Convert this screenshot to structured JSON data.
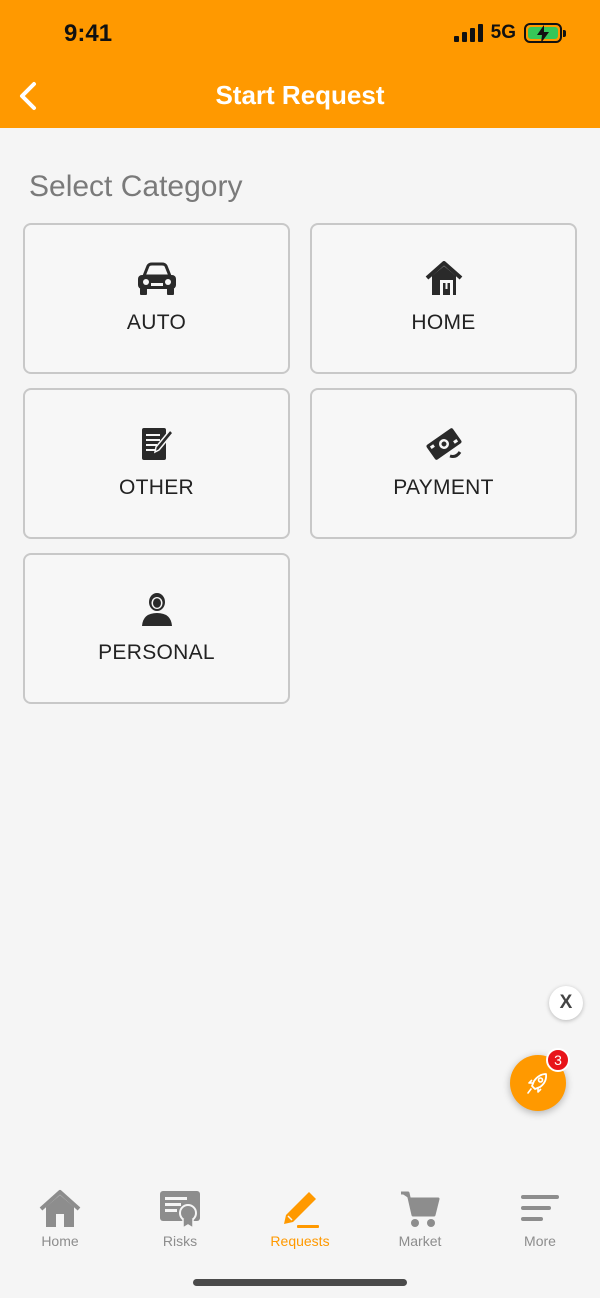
{
  "status_bar": {
    "time": "9:41",
    "network": "5G"
  },
  "header": {
    "title": "Start Request",
    "back_icon": "chevron-left-icon"
  },
  "section_title": "Select Category",
  "categories": [
    {
      "label": "AUTO",
      "icon": "car-icon"
    },
    {
      "label": "HOME",
      "icon": "house-icon"
    },
    {
      "label": "OTHER",
      "icon": "document-edit-icon"
    },
    {
      "label": "PAYMENT",
      "icon": "money-icon"
    },
    {
      "label": "PERSONAL",
      "icon": "person-icon"
    }
  ],
  "fab": {
    "close_label": "X",
    "badge_count": "3",
    "icon": "rocket-icon"
  },
  "tabbar": [
    {
      "label": "Home",
      "icon": "house-icon",
      "active": false
    },
    {
      "label": "Risks",
      "icon": "certificate-icon",
      "active": false
    },
    {
      "label": "Requests",
      "icon": "pencil-icon",
      "active": true
    },
    {
      "label": "Market",
      "icon": "cart-icon",
      "active": false
    },
    {
      "label": "More",
      "icon": "menu-icon",
      "active": false
    }
  ],
  "colors": {
    "accent": "#ff9900",
    "badge": "#e8141a",
    "tab_inactive": "#8d8d8d"
  }
}
